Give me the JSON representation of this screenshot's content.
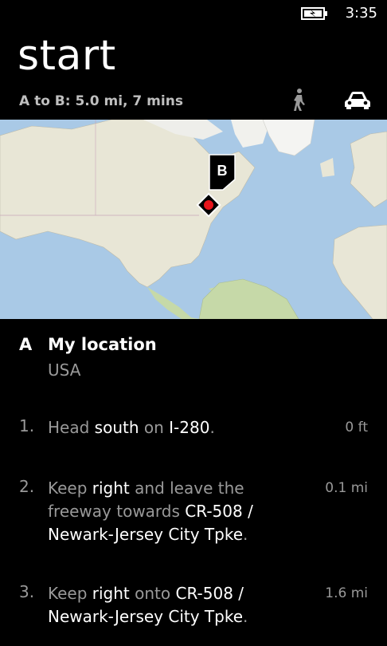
{
  "status": {
    "time": "3:35"
  },
  "header": {
    "title": "start",
    "summary": "A to B:  5.0 mi, 7 mins"
  },
  "map": {
    "destination_label": "B",
    "colors": {
      "water": "#a9c9e6",
      "land": "#e8e6d6",
      "vegetation": "#c6d9a8",
      "marker": "#e8141b"
    }
  },
  "origin": {
    "letter": "A",
    "name": "My location",
    "country": "USA"
  },
  "steps": [
    {
      "number": "1.",
      "parts": [
        "Head ",
        "south",
        " on ",
        "I-280",
        "."
      ],
      "distance": "0 ft"
    },
    {
      "number": "2.",
      "parts": [
        "Keep ",
        "right",
        " and leave the freeway towards ",
        "CR-508 / Newark-Jersey City Tpke",
        "."
      ],
      "distance": "0.1 mi"
    },
    {
      "number": "3.",
      "parts": [
        "Keep ",
        "right",
        " onto ",
        "CR-508 / Newark-Jersey City Tpke",
        "."
      ],
      "distance": "1.6 mi"
    }
  ]
}
